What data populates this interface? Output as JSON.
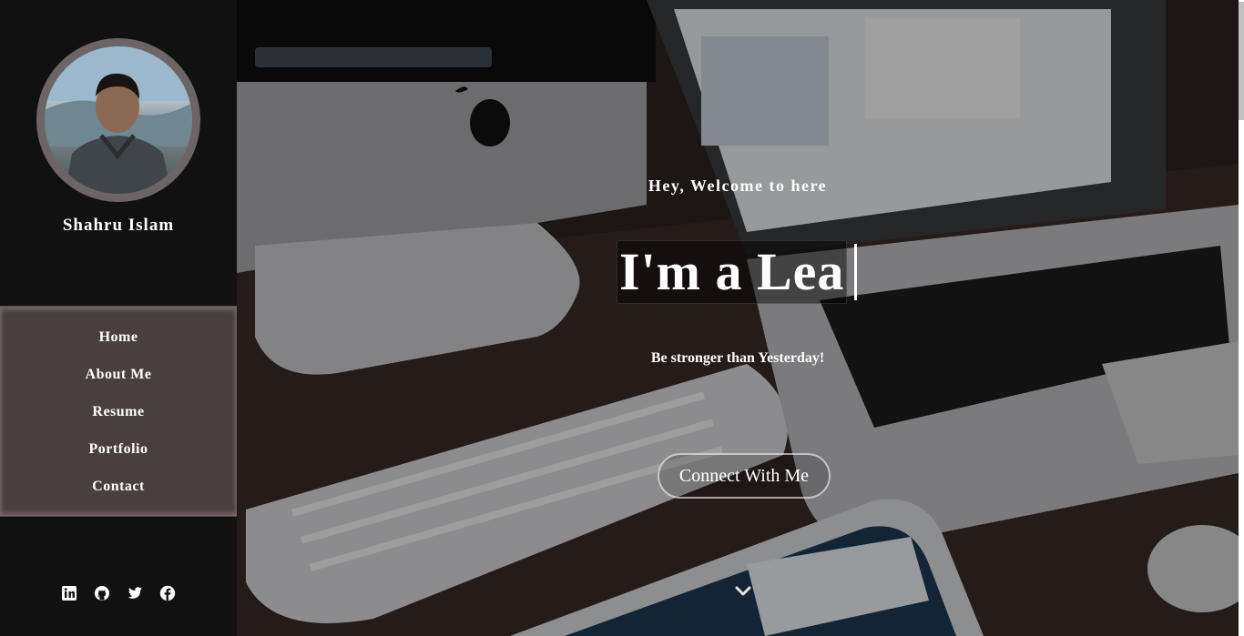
{
  "profile": {
    "name": "Shahru Islam",
    "avatar_icon": "profile-photo"
  },
  "nav": {
    "items": [
      {
        "label": "Home"
      },
      {
        "label": "About Me"
      },
      {
        "label": "Resume"
      },
      {
        "label": "Portfolio"
      },
      {
        "label": "Contact"
      }
    ]
  },
  "socials": [
    {
      "icon": "linkedin-icon"
    },
    {
      "icon": "github-icon"
    },
    {
      "icon": "twitter-icon"
    },
    {
      "icon": "facebook-icon"
    }
  ],
  "hero": {
    "greeting": "Hey, Welcome to here",
    "typed_text": "I'm a Lea",
    "tagline": "Be stronger than Yesterday!",
    "cta_label": "Connect With Me",
    "scroll_icon": "chevron-down-icon"
  },
  "colors": {
    "sidebar_bg": "#121111",
    "nav_bg": "#4a3f40",
    "avatar_ring": "#6d6565",
    "text": "#ffffff"
  }
}
